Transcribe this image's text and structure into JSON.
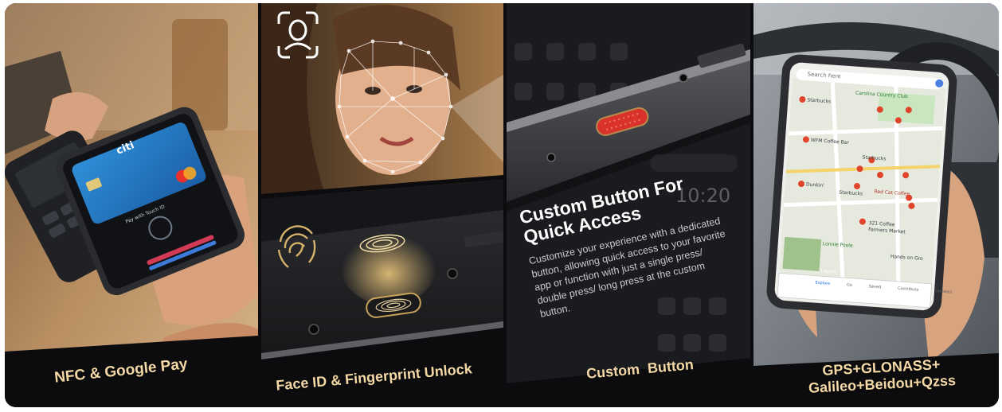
{
  "panels": [
    {
      "caption": "NFC & Google Pay",
      "card_brand": "citi",
      "pay_prompt": "Pay with Touch ID"
    },
    {
      "caption": "Face ID & Fingerprint Unlock"
    },
    {
      "caption": "Custom  Button",
      "heading_line1": "Custom Button For",
      "heading_line2": "Quick Access",
      "body_line1": "Customize your experience with a dedicated",
      "body_line2": "button, allowing quick access to your favorite",
      "body_line3": "app or function with just a single press/",
      "body_line4": "double press/ long press at the custom",
      "body_line5": "button.",
      "clock": "10:20"
    },
    {
      "caption_line1": "GPS+GLONASS+",
      "caption_line2": "Galileo+Beidou+Qzss",
      "map_search_placeholder": "Search here",
      "map_labels": [
        "Starbucks",
        "Carolina Country Club",
        "WFM Coffee Bar",
        "Starbucks",
        "Dunkin'",
        "Starbucks",
        "Red Cat Coffee",
        "321 Coffee",
        "Farmers Market",
        "Lonnie Poole",
        "Hands on Gro"
      ],
      "map_tabs": [
        "Explore",
        "Go",
        "Saved",
        "Contribute",
        "Updates"
      ],
      "layers_label": "Layers"
    }
  ],
  "colors": {
    "caption": "#f4d9a6",
    "accent_button": "#d8322a",
    "map_pin": "#e0442b",
    "gold": "#c9a45a"
  }
}
